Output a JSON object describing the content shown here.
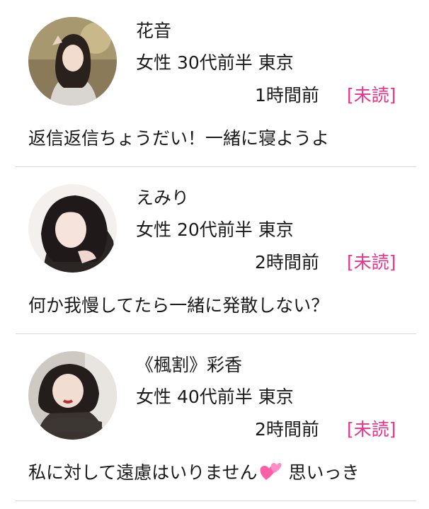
{
  "messages": [
    {
      "name": "花音",
      "profile": "女性 30代前半 東京",
      "time": "1時間前",
      "status": "[未読]",
      "preview": "返信返信ちょうだい！一緒に寝ようよ",
      "avatar_icon": "avatar-photo"
    },
    {
      "name": "えみり",
      "profile": "女性 20代前半 東京",
      "time": "2時間前",
      "status": "[未読]",
      "preview": "何か我慢してたら一緒に発散しない？",
      "avatar_icon": "avatar-photo"
    },
    {
      "name": "《楓割》彩香",
      "profile": "女性 40代前半 東京",
      "time": "2時間前",
      "status": "[未読]",
      "preview_before": "私に対して遠慮はいりません",
      "preview_icon": "two-hearts-icon",
      "preview_after": " 思いっき"
    }
  ],
  "colors": {
    "unread": "#e8338a",
    "divider": "#d9d9d9",
    "text": "#1a1a1a"
  }
}
